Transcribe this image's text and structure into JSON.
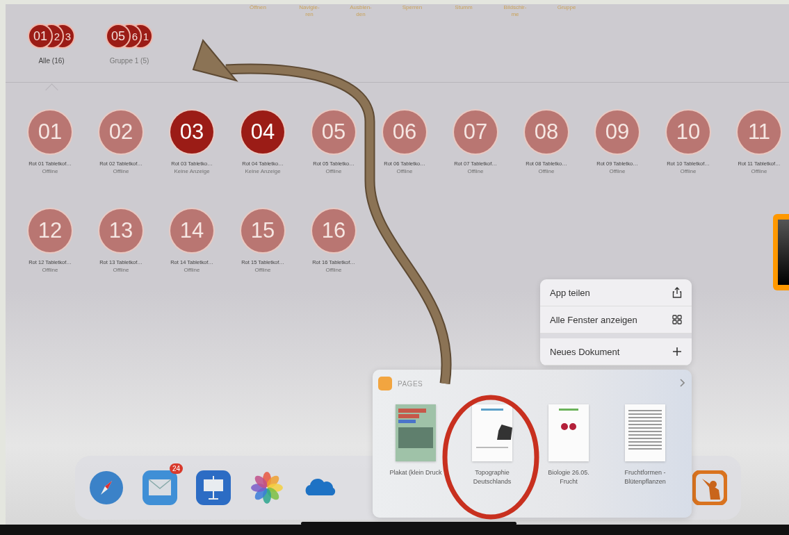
{
  "toolbar": [
    {
      "label": "Öffnen"
    },
    {
      "label": "Navigie-\nren"
    },
    {
      "label": "Ausblen-\nden"
    },
    {
      "label": "Sperren"
    },
    {
      "label": "Stumm"
    },
    {
      "label": "Bildschir-\nme"
    },
    {
      "label": "Gruppe"
    }
  ],
  "groups": [
    {
      "label": "Alle (16)",
      "selected": true,
      "badges": [
        "01",
        "2",
        "3"
      ]
    },
    {
      "label": "Gruppe 1 (5)",
      "selected": false,
      "badges": [
        "05",
        "6",
        "1"
      ]
    }
  ],
  "devices": [
    {
      "number": "01",
      "name": "Rot 01 Tabletkof…",
      "status": "Offline",
      "selected": false
    },
    {
      "number": "02",
      "name": "Rot 02 Tabletkof…",
      "status": "Offline",
      "selected": false
    },
    {
      "number": "03",
      "name": "Rot 03 Tabletko…",
      "status": "Keine Anzeige",
      "selected": true
    },
    {
      "number": "04",
      "name": "Rot 04 Tabletko…",
      "status": "Keine Anzeige",
      "selected": true
    },
    {
      "number": "05",
      "name": "Rot 05 Tabletko…",
      "status": "Offline",
      "selected": false
    },
    {
      "number": "06",
      "name": "Rot 06 Tabletko…",
      "status": "Offline",
      "selected": false
    },
    {
      "number": "07",
      "name": "Rot 07 Tabletkof…",
      "status": "Offline",
      "selected": false
    },
    {
      "number": "08",
      "name": "Rot 08 Tabletko…",
      "status": "Offline",
      "selected": false
    },
    {
      "number": "09",
      "name": "Rot 09 Tabletko…",
      "status": "Offline",
      "selected": false
    },
    {
      "number": "10",
      "name": "Rot 10 Tabletkof…",
      "status": "Offline",
      "selected": false
    },
    {
      "number": "11",
      "name": "Rot 11 Tabletkof…",
      "status": "Offline",
      "selected": false
    },
    {
      "number": "12",
      "name": "Rot 12 Tabletkof…",
      "status": "Offline",
      "selected": false
    },
    {
      "number": "13",
      "name": "Rot 13 Tabletkof…",
      "status": "Offline",
      "selected": false
    },
    {
      "number": "14",
      "name": "Rot 14 Tabletkof…",
      "status": "Offline",
      "selected": false
    },
    {
      "number": "15",
      "name": "Rot 15 Tabletkof…",
      "status": "Offline",
      "selected": false
    },
    {
      "number": "16",
      "name": "Rot 16 Tabletkof…",
      "status": "Offline",
      "selected": false
    }
  ],
  "context_menu": [
    {
      "label": "App teilen",
      "kind": "share"
    },
    {
      "label": "Alle Fenster anzeigen",
      "kind": "windows"
    },
    {
      "label": "Neues Dokument",
      "kind": "new"
    }
  ],
  "app_panel": {
    "title": "PAGES",
    "documents": [
      {
        "title": "Plakat (klein Druck",
        "kind": "poster"
      },
      {
        "title": "Topographie Deutschlands",
        "kind": "map"
      },
      {
        "title": "Biologie 26.05. Frucht",
        "kind": "cherry"
      },
      {
        "title": "Fruchtformen - Blütenpflanzen",
        "kind": "text"
      }
    ]
  },
  "dock": [
    {
      "kind": "safari"
    },
    {
      "kind": "mail",
      "badge": "24"
    },
    {
      "kind": "keynote"
    },
    {
      "kind": "photos"
    },
    {
      "kind": "cloud"
    },
    {
      "kind": "teacher"
    }
  ]
}
